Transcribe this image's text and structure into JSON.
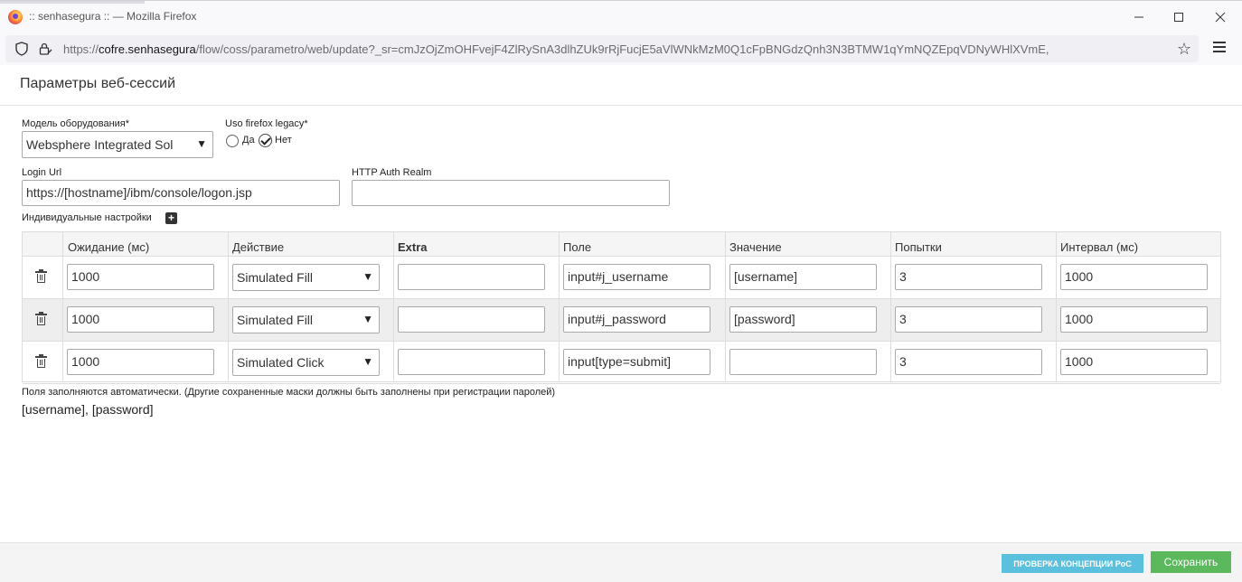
{
  "window": {
    "title": ":: senhasegura :: — Mozilla Firefox",
    "url_prefix": "https://",
    "url_host": "cofre.senhasegura",
    "url_path": "/flow/coss/parametro/web/update?_sr=cmJzOjZmOHFvejF4ZlRySnA3dlhZUk9rRjFucjE5aVlWNkMzM0Q1cFpBNGdzQnh3N3BTMW1qYmNQZEpqVDNyWHlXVmE,"
  },
  "page": {
    "title": "Параметры веб-сессий"
  },
  "form": {
    "device_model_label": "Модель оборудования*",
    "device_model_value": "Websphere Integrated Sol",
    "legacy_label": "Uso firefox legacy*",
    "legacy_yes": "Да",
    "legacy_no": "Нет",
    "legacy_selected": "Нет",
    "login_url_label": "Login Url",
    "login_url_value": "https://[hostname]/ibm/console/logon.jsp",
    "http_auth_label": "HTTP Auth Realm",
    "http_auth_value": "",
    "custom_settings_label": "Индивидуальные настройки"
  },
  "table": {
    "headers": [
      "Ожидание (мс)",
      "Действие",
      "Extra",
      "Поле",
      "Значение",
      "Попытки",
      "Интервал (мс)"
    ],
    "rows": [
      {
        "wait": "1000",
        "action": "Simulated Fill",
        "extra": "",
        "field": "input#j_username",
        "value": "[username]",
        "attempts": "3",
        "interval": "1000"
      },
      {
        "wait": "1000",
        "action": "Simulated Fill",
        "extra": "",
        "field": "input#j_password",
        "value": "[password]",
        "attempts": "3",
        "interval": "1000"
      },
      {
        "wait": "1000",
        "action": "Simulated Click",
        "extra": "",
        "field": "input[type=submit]",
        "value": "",
        "attempts": "3",
        "interval": "1000"
      }
    ]
  },
  "notes": {
    "auto_fill": "Поля заполняются автоматически. (Другие сохраненные маски должны быть заполнены при регистрации паролей)",
    "masks": "[username], [password]"
  },
  "footer": {
    "poc_button": "ПРОВЕРКА КОНЦЕПЦИИ PoC",
    "save_button": "Сохранить"
  },
  "colors": {
    "poc_button": "#5bc0de",
    "save_button": "#5cb85c"
  }
}
